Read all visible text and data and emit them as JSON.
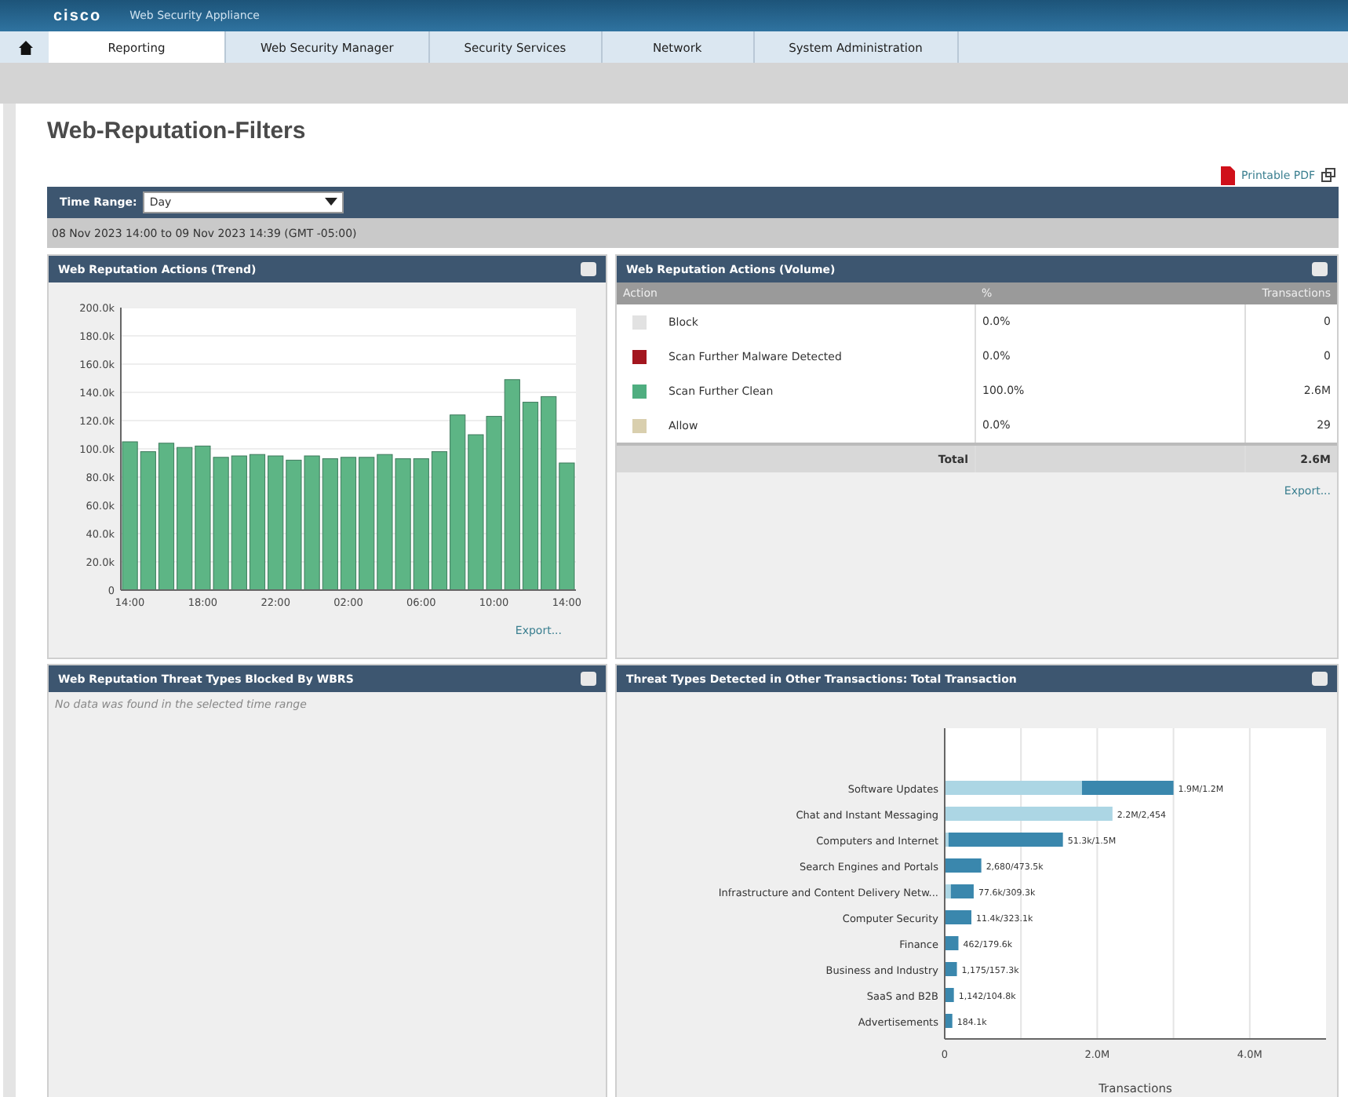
{
  "header": {
    "logo": "cisco",
    "product": "Web Security Appliance"
  },
  "nav": [
    {
      "label": "Reporting",
      "selected": true
    },
    {
      "label": "Web Security Manager",
      "selected": false
    },
    {
      "label": "Security Services",
      "selected": false
    },
    {
      "label": "Network",
      "selected": false
    },
    {
      "label": "System Administration",
      "selected": false
    }
  ],
  "page_title": "Web-Reputation-Filters",
  "printable_pdf": "Printable PDF",
  "time_range": {
    "label": "Time Range:",
    "value": "Day"
  },
  "date_range": "08 Nov 2023 14:00 to 09 Nov 2023 14:39 (GMT -05:00)",
  "trend": {
    "title": "Web Reputation Actions (Trend)",
    "export": "Export...",
    "chart_data": {
      "type": "bar",
      "grid": true,
      "categories": [
        "14:00",
        null,
        null,
        null,
        "18:00",
        null,
        null,
        null,
        "22:00",
        null,
        null,
        null,
        "02:00",
        null,
        null,
        null,
        "06:00",
        null,
        null,
        null,
        "10:00",
        null,
        null,
        null,
        "14:00"
      ],
      "series": [
        {
          "color": "#5db585",
          "values": [
            105,
            98,
            104,
            101,
            102,
            94,
            95,
            96,
            95,
            92,
            95,
            93,
            94,
            94,
            96,
            93,
            93,
            98,
            124,
            110,
            123,
            149,
            133,
            137,
            90
          ]
        }
      ],
      "ylim": [
        0,
        200
      ],
      "yticks": [
        {
          "value": 0,
          "label": "0"
        },
        {
          "value": 20,
          "label": "20.0k"
        },
        {
          "value": 40,
          "label": "40.0k"
        },
        {
          "value": 60,
          "label": "60.0k"
        },
        {
          "value": 80,
          "label": "80.0k"
        },
        {
          "value": 100,
          "label": "100.0k"
        },
        {
          "value": 120,
          "label": "120.0k"
        },
        {
          "value": 140,
          "label": "140.0k"
        },
        {
          "value": 160,
          "label": "160.0k"
        },
        {
          "value": 180,
          "label": "180.0k"
        },
        {
          "value": 200,
          "label": "200.0k"
        }
      ]
    }
  },
  "volume": {
    "title": "Web Reputation Actions (Volume)",
    "columns": [
      "Action",
      "%",
      "Transactions"
    ],
    "rows": [
      {
        "action": "Block",
        "percent": "0.0%",
        "transactions": "0",
        "color": "#e2e2e2"
      },
      {
        "action": "Scan Further Malware Detected",
        "percent": "0.0%",
        "transactions": "0",
        "color": "#a3161f"
      },
      {
        "action": "Scan Further Clean",
        "percent": "100.0%",
        "transactions": "2.6M",
        "color": "#4fae80"
      },
      {
        "action": "Allow",
        "percent": "0.0%",
        "transactions": "29",
        "color": "#d9cfae"
      }
    ],
    "total": {
      "label": "Total",
      "value": "2.6M"
    },
    "export": "Export..."
  },
  "blocked": {
    "title": "Web Reputation Threat Types Blocked By WBRS",
    "message": "No data was found in the selected time range"
  },
  "threats": {
    "title": "Threat Types Detected in Other Transactions: Total Transaction",
    "chart_data": {
      "type": "bar",
      "orientation": "horizontal",
      "stacked": true,
      "xlabel": "Transactions",
      "categories": [
        "Software Updates",
        "Chat and Instant Messaging",
        "Computers and Internet",
        "Search Engines and Portals",
        "Infrastructure and Content Delivery Netw...",
        "Computer Security",
        "Finance",
        "Business and Industry",
        "SaaS and B2B",
        "Advertisements"
      ],
      "series": [
        {
          "color": "#acd6e4",
          "values": [
            1.8,
            2.2,
            0.05,
            0,
            0.08,
            0,
            0,
            0,
            0,
            0
          ]
        },
        {
          "color": "#3a87ad",
          "values": [
            1.2,
            0,
            1.5,
            0.48,
            0.3,
            0.35,
            0.18,
            0.16,
            0.12,
            0.1
          ]
        }
      ],
      "value_labels": [
        "1.9M/1.2M",
        "2.2M/2,454",
        "51.3k/1.5M",
        "2,680/473.5k",
        "77.6k/309.3k",
        "11.4k/323.1k",
        "462/179.6k",
        "1,175/157.3k",
        "1,142/104.8k",
        "184.1k"
      ],
      "xlim": [
        0,
        5
      ],
      "xticks": [
        {
          "value": 0,
          "label": "0"
        },
        {
          "value": 2,
          "label": "2.0M"
        },
        {
          "value": 4,
          "label": "4.0M"
        }
      ]
    }
  }
}
